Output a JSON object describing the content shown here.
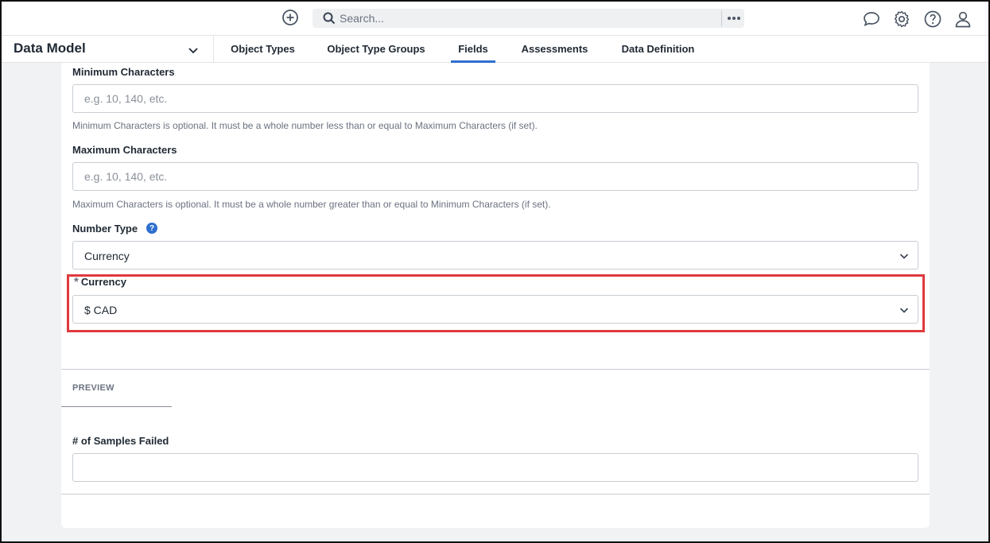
{
  "header": {
    "add_icon": "plus-circle-icon",
    "search_placeholder": "Search...",
    "more_icon": "more-dots-icon",
    "icons": [
      "chat-icon",
      "gear-icon",
      "help-icon",
      "user-icon"
    ]
  },
  "subnav": {
    "module_title": "Data Model",
    "tabs": [
      {
        "label": "Object Types",
        "active": false
      },
      {
        "label": "Object Type Groups",
        "active": false
      },
      {
        "label": "Fields",
        "active": true
      },
      {
        "label": "Assessments",
        "active": false
      },
      {
        "label": "Data Definition",
        "active": false
      }
    ]
  },
  "form": {
    "min_chars": {
      "label": "Minimum Characters",
      "placeholder": "e.g. 10, 140, etc.",
      "help": "Minimum Characters is optional. It must be a whole number less than or equal to Maximum Characters (if set)."
    },
    "max_chars": {
      "label": "Maximum Characters",
      "placeholder": "e.g. 10, 140, etc.",
      "help": "Maximum Characters is optional. It must be a whole number greater than or equal to Minimum Characters (if set)."
    },
    "number_type": {
      "label": "Number Type",
      "help_badge": "?",
      "value": "Currency"
    },
    "currency": {
      "required_mark": "*",
      "label": "Currency",
      "value": "$ CAD"
    }
  },
  "preview": {
    "tab_label": "PREVIEW",
    "field_label": "# of Samples Failed",
    "field_value": ""
  },
  "colors": {
    "accent": "#2f6fd0",
    "highlight": "#e0393e"
  }
}
